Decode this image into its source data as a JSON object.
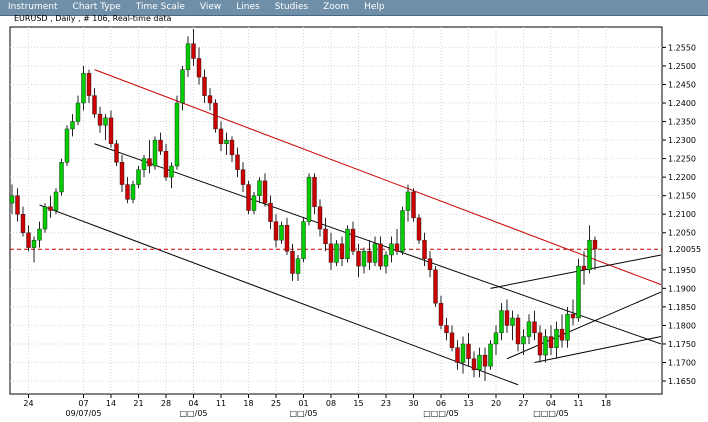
{
  "menu": {
    "items": [
      "Instrument",
      "Chart Type",
      "Time Scale",
      "View",
      "Lines",
      "Studies",
      "Zoom",
      "Help"
    ]
  },
  "chart_data": {
    "type": "candlestick",
    "title": "EURUSD , Daily , # 106, Real-time data",
    "ylim": [
      1.1615,
      1.2605
    ],
    "y_ticks": [
      "1.2550",
      "1.2500",
      "1.2450",
      "1.2400",
      "1.2350",
      "1.2300",
      "1.2250",
      "1.2200",
      "1.2150",
      "1.2100",
      "1.2050",
      "1.1950",
      "1.1900",
      "1.1850",
      "1.1800",
      "1.1750",
      "1.1700",
      "1.1650"
    ],
    "current_price": "1.20055",
    "x_ticks": [
      {
        "label": "24",
        "bar": 3
      },
      {
        "label": "07",
        "bar": 13
      },
      {
        "label": "14",
        "bar": 18
      },
      {
        "label": "21",
        "bar": 23
      },
      {
        "label": "28",
        "bar": 28
      },
      {
        "label": "04",
        "bar": 33
      },
      {
        "label": "11",
        "bar": 38
      },
      {
        "label": "18",
        "bar": 43
      },
      {
        "label": "25",
        "bar": 48
      },
      {
        "label": "01",
        "bar": 53
      },
      {
        "label": "08",
        "bar": 58
      },
      {
        "label": "15",
        "bar": 63
      },
      {
        "label": "23",
        "bar": 68
      },
      {
        "label": "30",
        "bar": 73
      },
      {
        "label": "06",
        "bar": 78
      },
      {
        "label": "13",
        "bar": 83
      },
      {
        "label": "20",
        "bar": 88
      },
      {
        "label": "27",
        "bar": 93
      },
      {
        "label": "04",
        "bar": 98
      },
      {
        "label": "11",
        "bar": 103
      },
      {
        "label": "18",
        "bar": 108
      }
    ],
    "x_sublabels": [
      {
        "label": "09/07/05",
        "bar": 13
      },
      {
        "label": "□□/05",
        "bar": 33
      },
      {
        "label": "□□/05",
        "bar": 53
      },
      {
        "label": "□□□/05",
        "bar": 78
      },
      {
        "label": "□□□/05",
        "bar": 98
      }
    ],
    "candles": [
      {
        "o": 1.213,
        "h": 1.218,
        "l": 1.21,
        "c": 1.215
      },
      {
        "o": 1.215,
        "h": 1.217,
        "l": 1.208,
        "c": 1.21
      },
      {
        "o": 1.21,
        "h": 1.212,
        "l": 1.204,
        "c": 1.205
      },
      {
        "o": 1.205,
        "h": 1.207,
        "l": 1.2,
        "c": 1.201
      },
      {
        "o": 1.201,
        "h": 1.204,
        "l": 1.197,
        "c": 1.203
      },
      {
        "o": 1.203,
        "h": 1.208,
        "l": 1.201,
        "c": 1.206
      },
      {
        "o": 1.206,
        "h": 1.213,
        "l": 1.205,
        "c": 1.212
      },
      {
        "o": 1.212,
        "h": 1.215,
        "l": 1.209,
        "c": 1.211
      },
      {
        "o": 1.211,
        "h": 1.217,
        "l": 1.21,
        "c": 1.216
      },
      {
        "o": 1.216,
        "h": 1.225,
        "l": 1.215,
        "c": 1.224
      },
      {
        "o": 1.224,
        "h": 1.234,
        "l": 1.223,
        "c": 1.233
      },
      {
        "o": 1.233,
        "h": 1.237,
        "l": 1.231,
        "c": 1.235
      },
      {
        "o": 1.235,
        "h": 1.242,
        "l": 1.234,
        "c": 1.24
      },
      {
        "o": 1.24,
        "h": 1.25,
        "l": 1.238,
        "c": 1.248
      },
      {
        "o": 1.248,
        "h": 1.249,
        "l": 1.24,
        "c": 1.242
      },
      {
        "o": 1.242,
        "h": 1.244,
        "l": 1.236,
        "c": 1.237
      },
      {
        "o": 1.237,
        "h": 1.239,
        "l": 1.232,
        "c": 1.234
      },
      {
        "o": 1.234,
        "h": 1.237,
        "l": 1.23,
        "c": 1.236
      },
      {
        "o": 1.236,
        "h": 1.238,
        "l": 1.228,
        "c": 1.229
      },
      {
        "o": 1.229,
        "h": 1.23,
        "l": 1.223,
        "c": 1.224
      },
      {
        "o": 1.224,
        "h": 1.226,
        "l": 1.216,
        "c": 1.218
      },
      {
        "o": 1.218,
        "h": 1.22,
        "l": 1.213,
        "c": 1.214
      },
      {
        "o": 1.214,
        "h": 1.219,
        "l": 1.213,
        "c": 1.218
      },
      {
        "o": 1.218,
        "h": 1.223,
        "l": 1.217,
        "c": 1.222
      },
      {
        "o": 1.222,
        "h": 1.226,
        "l": 1.22,
        "c": 1.225
      },
      {
        "o": 1.225,
        "h": 1.23,
        "l": 1.221,
        "c": 1.223
      },
      {
        "o": 1.223,
        "h": 1.231,
        "l": 1.222,
        "c": 1.23
      },
      {
        "o": 1.23,
        "h": 1.232,
        "l": 1.226,
        "c": 1.227
      },
      {
        "o": 1.227,
        "h": 1.229,
        "l": 1.219,
        "c": 1.22
      },
      {
        "o": 1.22,
        "h": 1.224,
        "l": 1.217,
        "c": 1.223
      },
      {
        "o": 1.223,
        "h": 1.242,
        "l": 1.222,
        "c": 1.24
      },
      {
        "o": 1.24,
        "h": 1.25,
        "l": 1.238,
        "c": 1.249
      },
      {
        "o": 1.249,
        "h": 1.258,
        "l": 1.247,
        "c": 1.256
      },
      {
        "o": 1.256,
        "h": 1.26,
        "l": 1.25,
        "c": 1.252
      },
      {
        "o": 1.252,
        "h": 1.255,
        "l": 1.245,
        "c": 1.247
      },
      {
        "o": 1.247,
        "h": 1.249,
        "l": 1.24,
        "c": 1.242
      },
      {
        "o": 1.242,
        "h": 1.244,
        "l": 1.238,
        "c": 1.24
      },
      {
        "o": 1.24,
        "h": 1.241,
        "l": 1.232,
        "c": 1.233
      },
      {
        "o": 1.233,
        "h": 1.235,
        "l": 1.227,
        "c": 1.229
      },
      {
        "o": 1.229,
        "h": 1.232,
        "l": 1.226,
        "c": 1.23
      },
      {
        "o": 1.23,
        "h": 1.231,
        "l": 1.224,
        "c": 1.226
      },
      {
        "o": 1.226,
        "h": 1.228,
        "l": 1.22,
        "c": 1.222
      },
      {
        "o": 1.222,
        "h": 1.224,
        "l": 1.216,
        "c": 1.218
      },
      {
        "o": 1.218,
        "h": 1.219,
        "l": 1.21,
        "c": 1.211
      },
      {
        "o": 1.211,
        "h": 1.216,
        "l": 1.21,
        "c": 1.215
      },
      {
        "o": 1.215,
        "h": 1.22,
        "l": 1.213,
        "c": 1.219
      },
      {
        "o": 1.219,
        "h": 1.221,
        "l": 1.212,
        "c": 1.213
      },
      {
        "o": 1.213,
        "h": 1.215,
        "l": 1.206,
        "c": 1.208
      },
      {
        "o": 1.208,
        "h": 1.21,
        "l": 1.201,
        "c": 1.203
      },
      {
        "o": 1.203,
        "h": 1.208,
        "l": 1.202,
        "c": 1.207
      },
      {
        "o": 1.207,
        "h": 1.209,
        "l": 1.199,
        "c": 1.2
      },
      {
        "o": 1.2,
        "h": 1.202,
        "l": 1.192,
        "c": 1.194
      },
      {
        "o": 1.194,
        "h": 1.199,
        "l": 1.192,
        "c": 1.198
      },
      {
        "o": 1.198,
        "h": 1.209,
        "l": 1.197,
        "c": 1.208
      },
      {
        "o": 1.208,
        "h": 1.221,
        "l": 1.207,
        "c": 1.22
      },
      {
        "o": 1.22,
        "h": 1.221,
        "l": 1.21,
        "c": 1.212
      },
      {
        "o": 1.212,
        "h": 1.214,
        "l": 1.204,
        "c": 1.206
      },
      {
        "o": 1.206,
        "h": 1.209,
        "l": 1.2,
        "c": 1.202
      },
      {
        "o": 1.202,
        "h": 1.205,
        "l": 1.195,
        "c": 1.197
      },
      {
        "o": 1.197,
        "h": 1.203,
        "l": 1.196,
        "c": 1.202
      },
      {
        "o": 1.202,
        "h": 1.204,
        "l": 1.196,
        "c": 1.198
      },
      {
        "o": 1.198,
        "h": 1.207,
        "l": 1.197,
        "c": 1.206
      },
      {
        "o": 1.206,
        "h": 1.208,
        "l": 1.199,
        "c": 1.2
      },
      {
        "o": 1.2,
        "h": 1.202,
        "l": 1.193,
        "c": 1.196
      },
      {
        "o": 1.196,
        "h": 1.201,
        "l": 1.194,
        "c": 1.2
      },
      {
        "o": 1.2,
        "h": 1.203,
        "l": 1.195,
        "c": 1.197
      },
      {
        "o": 1.197,
        "h": 1.204,
        "l": 1.196,
        "c": 1.202
      },
      {
        "o": 1.202,
        "h": 1.204,
        "l": 1.195,
        "c": 1.196
      },
      {
        "o": 1.196,
        "h": 1.2,
        "l": 1.194,
        "c": 1.199
      },
      {
        "o": 1.199,
        "h": 1.204,
        "l": 1.197,
        "c": 1.202
      },
      {
        "o": 1.202,
        "h": 1.206,
        "l": 1.199,
        "c": 1.2
      },
      {
        "o": 1.2,
        "h": 1.212,
        "l": 1.199,
        "c": 1.211
      },
      {
        "o": 1.211,
        "h": 1.218,
        "l": 1.208,
        "c": 1.216
      },
      {
        "o": 1.216,
        "h": 1.217,
        "l": 1.208,
        "c": 1.209
      },
      {
        "o": 1.209,
        "h": 1.21,
        "l": 1.202,
        "c": 1.203
      },
      {
        "o": 1.203,
        "h": 1.205,
        "l": 1.196,
        "c": 1.198
      },
      {
        "o": 1.198,
        "h": 1.2,
        "l": 1.193,
        "c": 1.195
      },
      {
        "o": 1.195,
        "h": 1.196,
        "l": 1.185,
        "c": 1.186
      },
      {
        "o": 1.186,
        "h": 1.188,
        "l": 1.179,
        "c": 1.18
      },
      {
        "o": 1.18,
        "h": 1.182,
        "l": 1.176,
        "c": 1.178
      },
      {
        "o": 1.178,
        "h": 1.18,
        "l": 1.173,
        "c": 1.174
      },
      {
        "o": 1.174,
        "h": 1.176,
        "l": 1.168,
        "c": 1.17
      },
      {
        "o": 1.17,
        "h": 1.177,
        "l": 1.167,
        "c": 1.175
      },
      {
        "o": 1.175,
        "h": 1.178,
        "l": 1.169,
        "c": 1.171
      },
      {
        "o": 1.171,
        "h": 1.173,
        "l": 1.166,
        "c": 1.168
      },
      {
        "o": 1.168,
        "h": 1.174,
        "l": 1.166,
        "c": 1.172
      },
      {
        "o": 1.172,
        "h": 1.174,
        "l": 1.165,
        "c": 1.169
      },
      {
        "o": 1.169,
        "h": 1.176,
        "l": 1.168,
        "c": 1.175
      },
      {
        "o": 1.175,
        "h": 1.18,
        "l": 1.172,
        "c": 1.178
      },
      {
        "o": 1.178,
        "h": 1.186,
        "l": 1.176,
        "c": 1.184
      },
      {
        "o": 1.184,
        "h": 1.187,
        "l": 1.178,
        "c": 1.18
      },
      {
        "o": 1.18,
        "h": 1.184,
        "l": 1.176,
        "c": 1.182
      },
      {
        "o": 1.182,
        "h": 1.183,
        "l": 1.173,
        "c": 1.175
      },
      {
        "o": 1.175,
        "h": 1.179,
        "l": 1.172,
        "c": 1.177
      },
      {
        "o": 1.177,
        "h": 1.183,
        "l": 1.175,
        "c": 1.181
      },
      {
        "o": 1.181,
        "h": 1.184,
        "l": 1.176,
        "c": 1.178
      },
      {
        "o": 1.178,
        "h": 1.18,
        "l": 1.17,
        "c": 1.172
      },
      {
        "o": 1.172,
        "h": 1.179,
        "l": 1.17,
        "c": 1.177
      },
      {
        "o": 1.177,
        "h": 1.18,
        "l": 1.172,
        "c": 1.174
      },
      {
        "o": 1.174,
        "h": 1.181,
        "l": 1.171,
        "c": 1.179
      },
      {
        "o": 1.179,
        "h": 1.183,
        "l": 1.174,
        "c": 1.176
      },
      {
        "o": 1.176,
        "h": 1.185,
        "l": 1.174,
        "c": 1.183
      },
      {
        "o": 1.183,
        "h": 1.187,
        "l": 1.18,
        "c": 1.182
      },
      {
        "o": 1.182,
        "h": 1.198,
        "l": 1.181,
        "c": 1.196
      },
      {
        "o": 1.196,
        "h": 1.2,
        "l": 1.191,
        "c": 1.195
      },
      {
        "o": 1.195,
        "h": 1.207,
        "l": 1.194,
        "c": 1.203
      },
      {
        "o": 1.203,
        "h": 1.204,
        "l": 1.195,
        "c": 1.2006
      }
    ]
  },
  "colors": {
    "menubar": "#6f8fa8",
    "up": "#00cc00",
    "down": "#cc0000",
    "trend_red": "#cc0000",
    "grid": "#d4d4d4"
  }
}
